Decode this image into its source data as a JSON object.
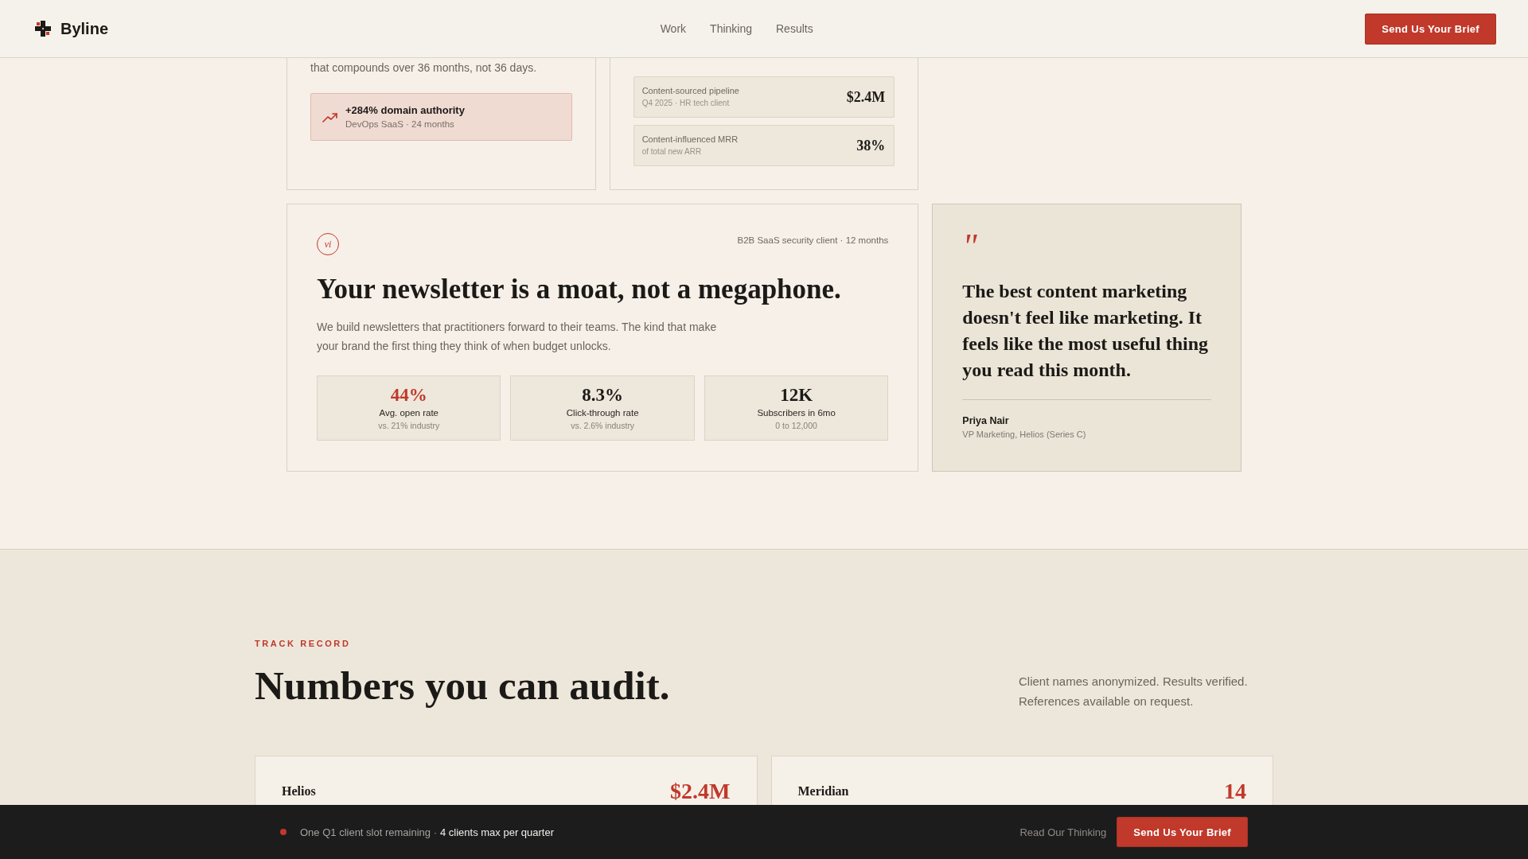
{
  "nav": {
    "brand": "Byline",
    "links": [
      "Work",
      "Thinking",
      "Results"
    ],
    "cta": "Send Us Your Brief"
  },
  "top_cards": [
    {
      "kind": "callout",
      "body": "that compounds over 36 months, not 36 days.",
      "callout": {
        "title": "+284% domain authority",
        "detail": "DevOps SaaS · 24 months"
      }
    },
    {
      "kind": "metrics",
      "metrics": [
        {
          "label": "Content-sourced pipeline",
          "detail": "Q4 2025 · HR tech client",
          "value": "$2.4M"
        },
        {
          "label": "Content-influenced MRR",
          "detail": "of total new ARR",
          "value": "38%"
        }
      ]
    }
  ],
  "feature_card": {
    "numeral": "vi",
    "meta": "B2B SaaS security client · 12 months",
    "title": "Your newsletter is a moat, not a megaphone.",
    "body": "We build newsletters that practitioners forward to their teams. The kind that make your brand the first thing they think of when budget unlocks.",
    "stats": [
      {
        "value": "44%",
        "label": "Avg. open rate",
        "detail": "vs. 21% industry",
        "highlighted": true
      },
      {
        "value": "8.3%",
        "label": "Click-through rate",
        "detail": "vs. 2.6% industry",
        "highlighted": false
      },
      {
        "value": "12K",
        "label": "Subscribers in 6mo",
        "detail": "0 to 12,000",
        "highlighted": false
      }
    ]
  },
  "quote_card": {
    "mark": "\"",
    "quote": "The best content marketing doesn't feel like marketing. It feels like the most useful thing you read this month.",
    "author": "Priya Nair",
    "role": "VP Marketing, Helios (Series C)"
  },
  "track_record": {
    "eyebrow": "TRACK RECORD",
    "title": "Numbers you can audit.",
    "note": "Client names anonymized. Results verified. References available on request.",
    "cards": [
      {
        "client": "Helios",
        "value": "$2.4M"
      },
      {
        "client": "Meridian",
        "value": "14"
      }
    ]
  },
  "bottom_bar": {
    "availability": "One Q1 client slot remaining ·",
    "capacity": "4 clients max per quarter",
    "link": "Read Our Thinking",
    "cta": "Send Us Your Brief"
  }
}
